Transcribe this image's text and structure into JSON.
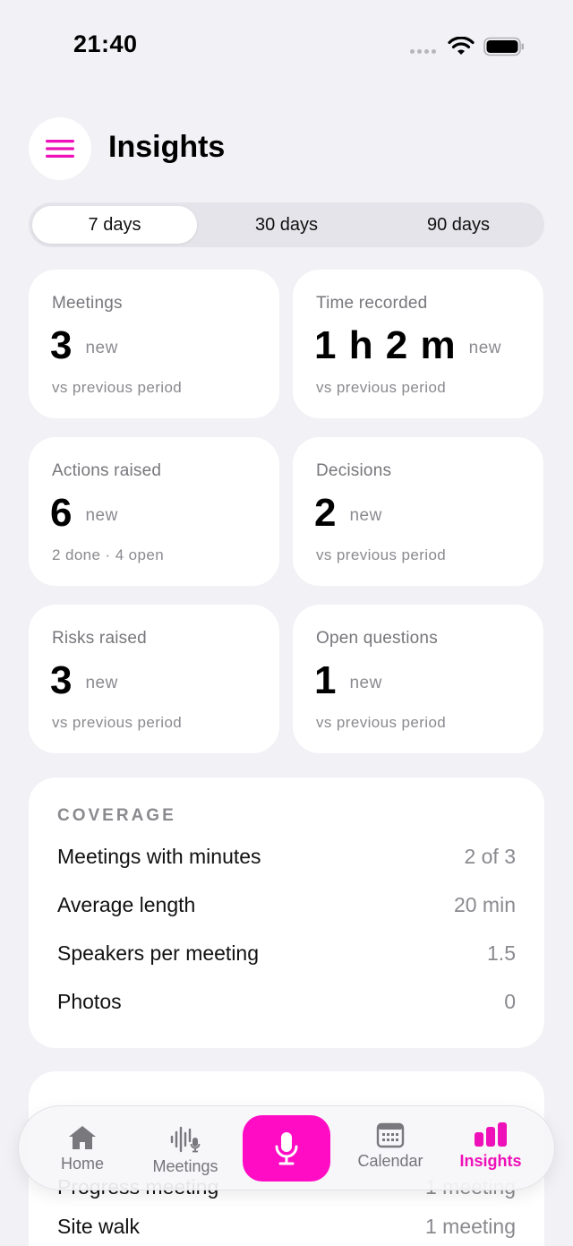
{
  "status_bar": {
    "time": "21:40"
  },
  "header": {
    "title": "Insights"
  },
  "period_tabs": [
    {
      "label": "7 days",
      "selected": true
    },
    {
      "label": "30 days",
      "selected": false
    },
    {
      "label": "90 days",
      "selected": false
    }
  ],
  "stats": [
    {
      "label": "Meetings",
      "value": "3",
      "badge": "new",
      "sub": "vs previous period"
    },
    {
      "label": "Time recorded",
      "value": "1 h 2 m",
      "badge": "new",
      "sub": "vs previous period"
    },
    {
      "label": "Actions raised",
      "value": "6",
      "badge": "new",
      "sub": "2 done · 4 open"
    },
    {
      "label": "Decisions",
      "value": "2",
      "badge": "new",
      "sub": "vs previous period"
    },
    {
      "label": "Risks raised",
      "value": "3",
      "badge": "new",
      "sub": "vs previous period"
    },
    {
      "label": "Open questions",
      "value": "1",
      "badge": "new",
      "sub": "vs previous period"
    }
  ],
  "coverage": {
    "heading": "COVERAGE",
    "rows": [
      {
        "label": "Meetings with minutes",
        "value": "2 of 3"
      },
      {
        "label": "Average length",
        "value": "20 min"
      },
      {
        "label": "Speakers per meeting",
        "value": "1.5"
      },
      {
        "label": "Photos",
        "value": "0"
      }
    ]
  },
  "meeting_types": {
    "rows": [
      {
        "label": "Progress meeting",
        "value": "1 meeting"
      },
      {
        "label": "Site walk",
        "value": "1 meeting"
      }
    ]
  },
  "tab_bar": {
    "items": [
      {
        "label": "Home",
        "icon": "home-icon"
      },
      {
        "label": "Meetings",
        "icon": "waveform-mic-icon"
      },
      {
        "label": "Calendar",
        "icon": "calendar-icon"
      },
      {
        "label": "Insights",
        "icon": "bar-chart-icon",
        "active": true
      }
    ],
    "record_icon": "microphone-icon"
  },
  "colors": {
    "accent": "#ff0cc4",
    "background": "#f1f1f6",
    "card": "#ffffff",
    "muted_text": "#8a8a8f"
  }
}
